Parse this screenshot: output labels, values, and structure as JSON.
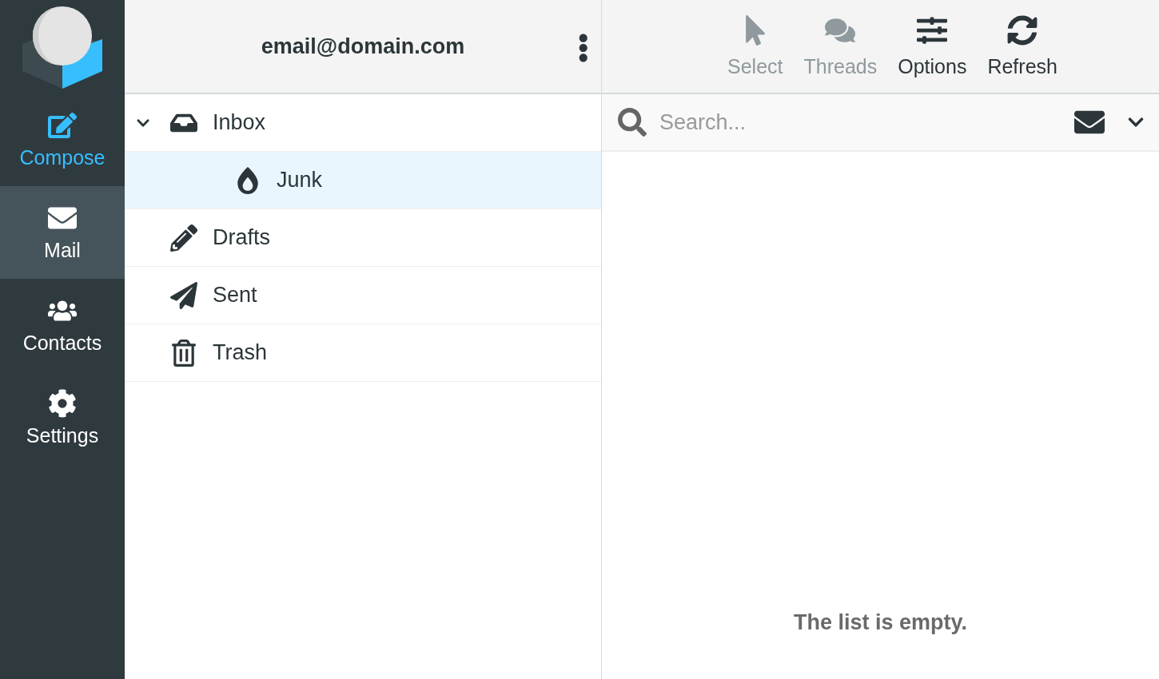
{
  "sidebar": {
    "items": [
      {
        "kind": "compose",
        "label": "Compose",
        "selected": false
      },
      {
        "kind": "mail",
        "label": "Mail",
        "selected": true
      },
      {
        "kind": "contacts",
        "label": "Contacts",
        "selected": false
      },
      {
        "kind": "settings",
        "label": "Settings",
        "selected": false
      }
    ]
  },
  "folders": {
    "account": "email@domain.com",
    "items": [
      {
        "kind": "inbox",
        "label": "Inbox",
        "selected": false,
        "expanded": true,
        "children": [
          {
            "kind": "junk",
            "label": "Junk",
            "selected": true
          }
        ]
      },
      {
        "kind": "drafts",
        "label": "Drafts",
        "selected": false
      },
      {
        "kind": "sent",
        "label": "Sent",
        "selected": false
      },
      {
        "kind": "trash",
        "label": "Trash",
        "selected": false
      }
    ]
  },
  "toolbar": [
    {
      "kind": "select",
      "label": "Select",
      "disabled": true
    },
    {
      "kind": "threads",
      "label": "Threads",
      "disabled": true
    },
    {
      "kind": "options",
      "label": "Options",
      "disabled": false
    },
    {
      "kind": "refresh",
      "label": "Refresh",
      "disabled": false
    }
  ],
  "search": {
    "placeholder": "Search..."
  },
  "message_list": {
    "empty_text": "The list is empty."
  }
}
